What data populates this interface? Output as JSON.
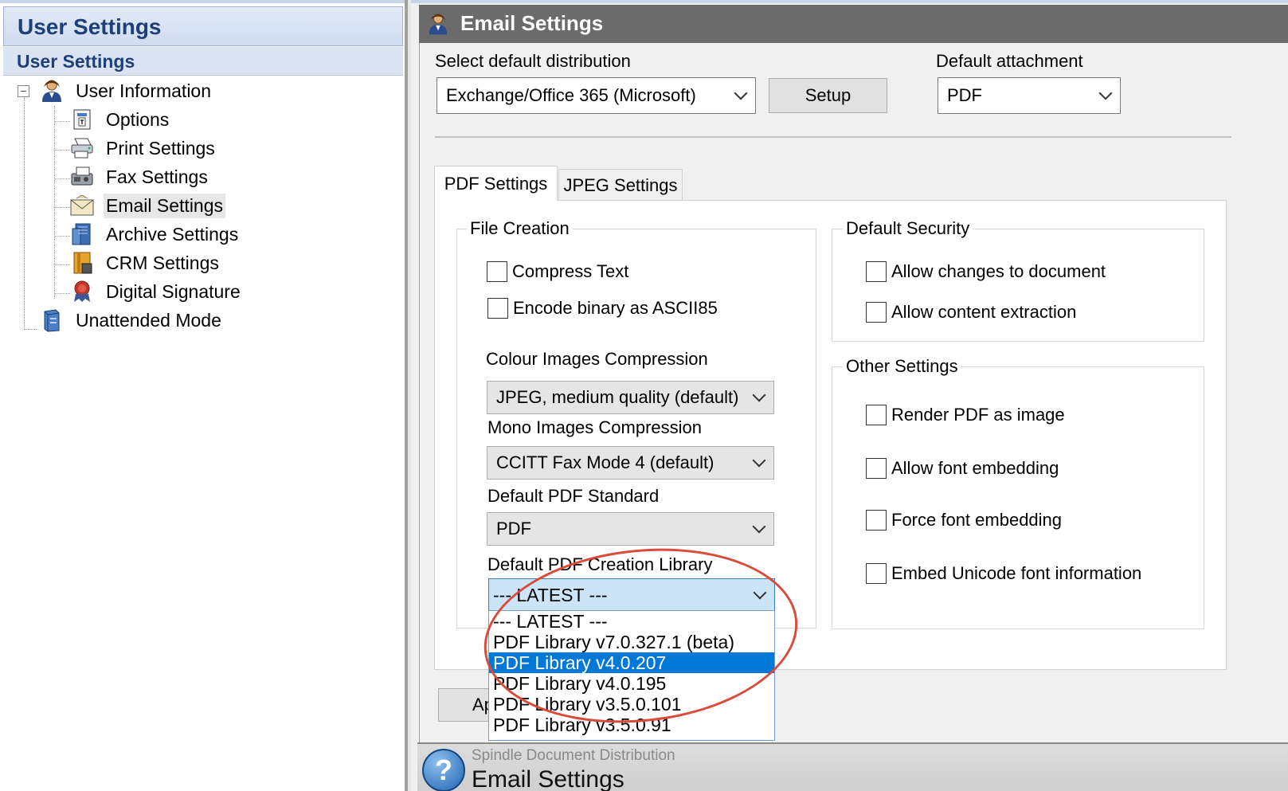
{
  "left": {
    "header": "User Settings",
    "subheader": "User Settings",
    "tree": [
      {
        "label": "User Information",
        "icon": "user-icon",
        "level": 0
      },
      {
        "label": "Options",
        "icon": "options-icon",
        "level": 1
      },
      {
        "label": "Print Settings",
        "icon": "printer-icon",
        "level": 1
      },
      {
        "label": "Fax Settings",
        "icon": "fax-icon",
        "level": 1
      },
      {
        "label": "Email Settings",
        "icon": "envelope-icon",
        "level": 1,
        "selected": true
      },
      {
        "label": "Archive Settings",
        "icon": "archive-icon",
        "level": 1
      },
      {
        "label": "CRM Settings",
        "icon": "crm-icon",
        "level": 1
      },
      {
        "label": "Digital Signature",
        "icon": "seal-icon",
        "level": 1
      },
      {
        "label": "Unattended Mode",
        "icon": "server-icon",
        "level": 0
      }
    ]
  },
  "right": {
    "title": "Email Settings",
    "distribution_label": "Select default distribution",
    "distribution_value": "Exchange/Office 365 (Microsoft)",
    "setup_button": "Setup",
    "attachment_label": "Default attachment",
    "attachment_value": "PDF",
    "tabs": [
      "PDF Settings",
      "JPEG Settings"
    ],
    "file_creation": {
      "title": "File Creation",
      "compress_text": "Compress Text",
      "encode_binary": "Encode binary as ASCII85",
      "colour_label": "Colour Images Compression",
      "colour_value": "JPEG, medium quality (default)",
      "mono_label": "Mono Images Compression",
      "mono_value": "CCITT Fax Mode 4 (default)",
      "standard_label": "Default PDF Standard",
      "standard_value": "PDF",
      "library_label": "Default PDF Creation Library",
      "library_value": "--- LATEST ---"
    },
    "security": {
      "title": "Default Security",
      "allow_changes": "Allow changes to document",
      "allow_extraction": "Allow content extraction"
    },
    "other": {
      "title": "Other Settings",
      "render_image": "Render PDF as image",
      "allow_font_embed": "Allow font embedding",
      "force_font_embed": "Force font embedding",
      "embed_unicode": "Embed Unicode font information"
    },
    "library_options": [
      "--- LATEST ---",
      "PDF Library v7.0.327.1 (beta)",
      "PDF Library v4.0.207",
      "PDF Library v4.0.195",
      "PDF Library v3.5.0.101",
      "PDF Library v3.5.0.91"
    ],
    "library_highlighted_index": 2,
    "apply_button": "Ap"
  },
  "help": {
    "app_name": "Spindle Document Distribution",
    "title": "Email Settings"
  },
  "colors": {
    "accent_blue": "#1e3f78",
    "selection_blue": "#0078d7",
    "annotation_red": "#d94b3b"
  }
}
